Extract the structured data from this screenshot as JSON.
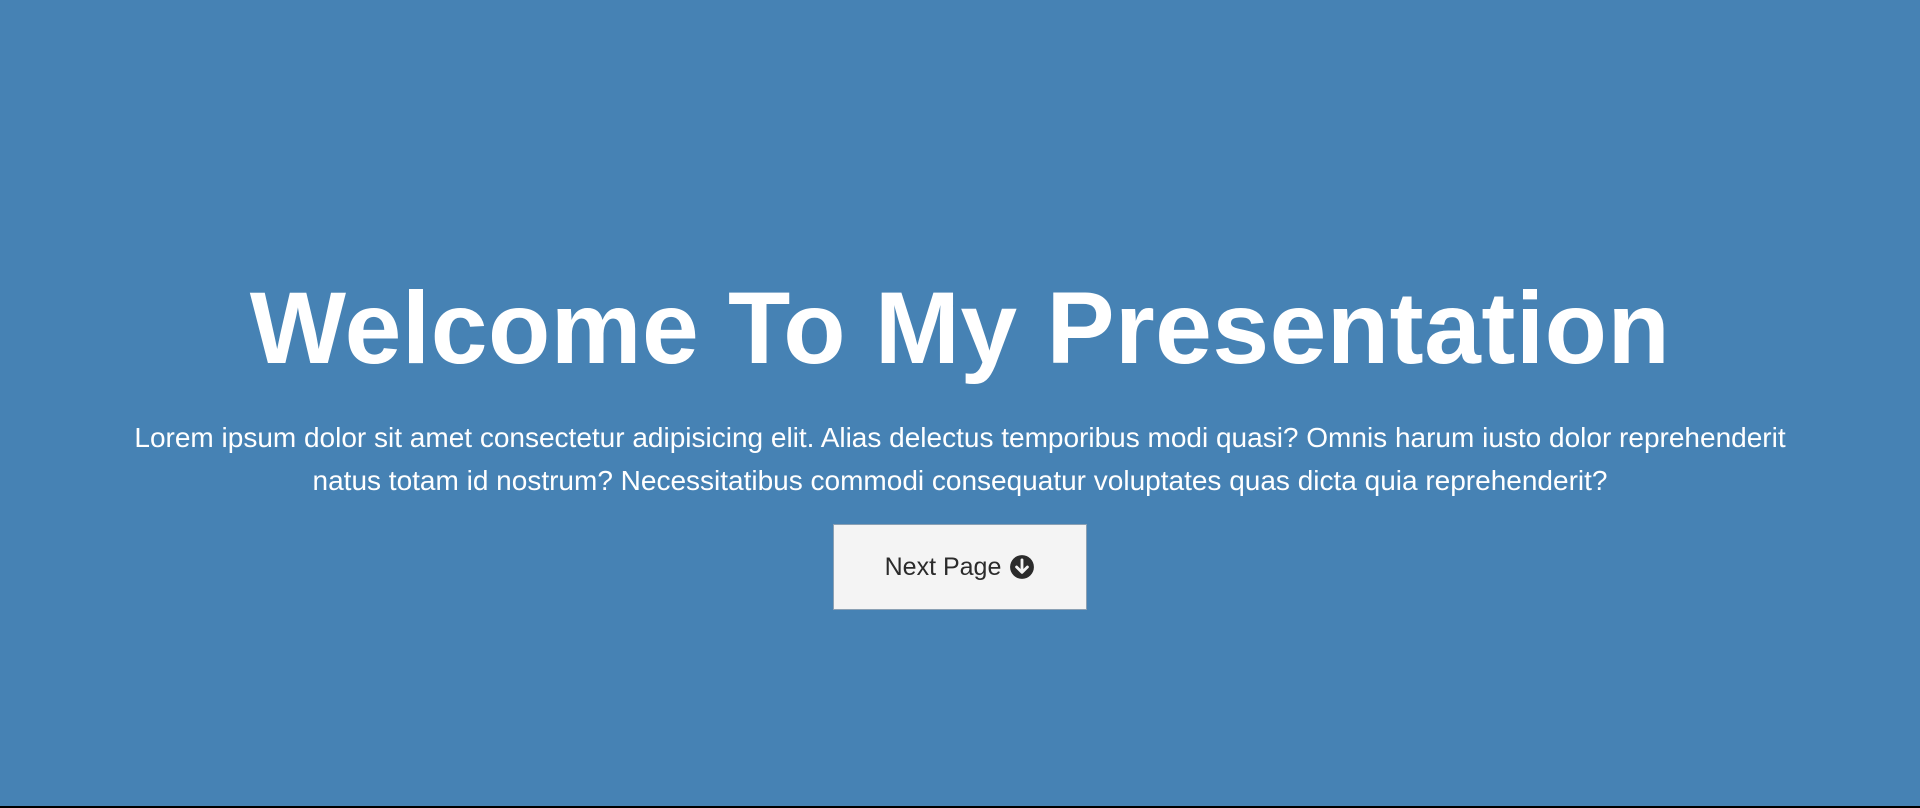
{
  "hero": {
    "title": "Welcome To My Presentation",
    "description": "Lorem ipsum dolor sit amet consectetur adipisicing elit. Alias delectus temporibus modi quasi? Omnis harum iusto dolor reprehenderit natus totam id nostrum? Necessitatibus commodi consequatur voluptates quas dicta quia reprehenderit?",
    "button_label": "Next Page",
    "button_icon": "arrow-circle-down-icon"
  },
  "colors": {
    "background": "#4682b4",
    "title_text": "#ffffff",
    "button_background": "#f4f4f4",
    "button_text": "#2b2b2b"
  }
}
